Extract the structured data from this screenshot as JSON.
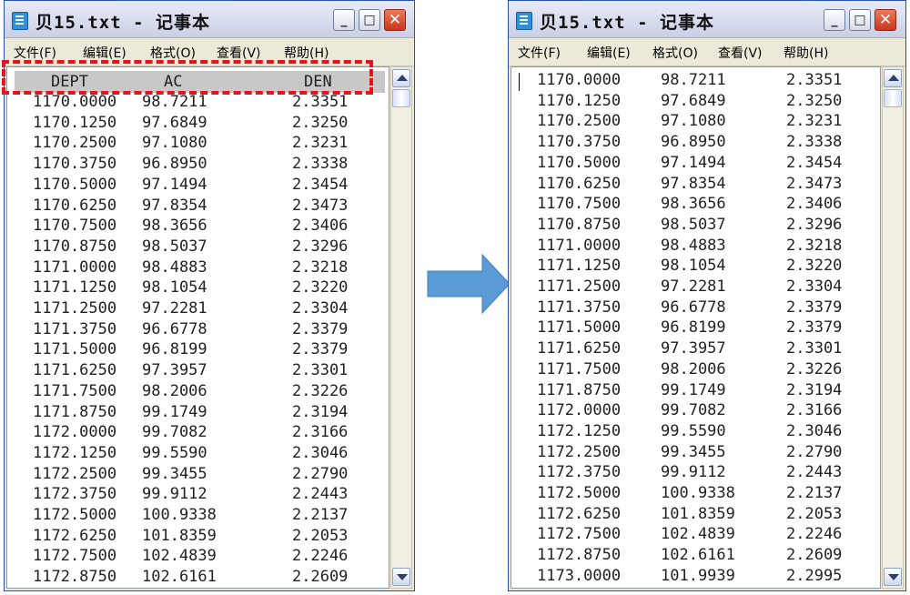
{
  "left_window": {
    "title": "贝15.txt - 记事本",
    "menu": [
      "文件(F)",
      "编辑(E)",
      "格式(O)",
      "查看(V)",
      "帮助(H)"
    ],
    "header": [
      "DEPT",
      "AC",
      "DEN"
    ],
    "rows": [
      [
        "1170.0000",
        "98.7211",
        "2.3351"
      ],
      [
        "1170.1250",
        "97.6849",
        "2.3250"
      ],
      [
        "1170.2500",
        "97.1080",
        "2.3231"
      ],
      [
        "1170.3750",
        "96.8950",
        "2.3338"
      ],
      [
        "1170.5000",
        "97.1494",
        "2.3454"
      ],
      [
        "1170.6250",
        "97.8354",
        "2.3473"
      ],
      [
        "1170.7500",
        "98.3656",
        "2.3406"
      ],
      [
        "1170.8750",
        "98.5037",
        "2.3296"
      ],
      [
        "1171.0000",
        "98.4883",
        "2.3218"
      ],
      [
        "1171.1250",
        "98.1054",
        "2.3220"
      ],
      [
        "1171.2500",
        "97.2281",
        "2.3304"
      ],
      [
        "1171.3750",
        "96.6778",
        "2.3379"
      ],
      [
        "1171.5000",
        "96.8199",
        "2.3379"
      ],
      [
        "1171.6250",
        "97.3957",
        "2.3301"
      ],
      [
        "1171.7500",
        "98.2006",
        "2.3226"
      ],
      [
        "1171.8750",
        "99.1749",
        "2.3194"
      ],
      [
        "1172.0000",
        "99.7082",
        "2.3166"
      ],
      [
        "1172.1250",
        "99.5590",
        "2.3046"
      ],
      [
        "1172.2500",
        "99.3455",
        "2.2790"
      ],
      [
        "1172.3750",
        "99.9112",
        "2.2443"
      ],
      [
        "1172.5000",
        "100.9338",
        "2.2137"
      ],
      [
        "1172.6250",
        "101.8359",
        "2.2053"
      ],
      [
        "1172.7500",
        "102.4839",
        "2.2246"
      ],
      [
        "1172.8750",
        "102.6161",
        "2.2609"
      ]
    ]
  },
  "right_window": {
    "title": "贝15.txt - 记事本",
    "menu": [
      "文件(F)",
      "编辑(E)",
      "格式(O)",
      "查看(V)",
      "帮助(H)"
    ],
    "rows": [
      [
        "1170.0000",
        "98.7211",
        "2.3351"
      ],
      [
        "1170.1250",
        "97.6849",
        "2.3250"
      ],
      [
        "1170.2500",
        "97.1080",
        "2.3231"
      ],
      [
        "1170.3750",
        "96.8950",
        "2.3338"
      ],
      [
        "1170.5000",
        "97.1494",
        "2.3454"
      ],
      [
        "1170.6250",
        "97.8354",
        "2.3473"
      ],
      [
        "1170.7500",
        "98.3656",
        "2.3406"
      ],
      [
        "1170.8750",
        "98.5037",
        "2.3296"
      ],
      [
        "1171.0000",
        "98.4883",
        "2.3218"
      ],
      [
        "1171.1250",
        "98.1054",
        "2.3220"
      ],
      [
        "1171.2500",
        "97.2281",
        "2.3304"
      ],
      [
        "1171.3750",
        "96.6778",
        "2.3379"
      ],
      [
        "1171.5000",
        "96.8199",
        "2.3379"
      ],
      [
        "1171.6250",
        "97.3957",
        "2.3301"
      ],
      [
        "1171.7500",
        "98.2006",
        "2.3226"
      ],
      [
        "1171.8750",
        "99.1749",
        "2.3194"
      ],
      [
        "1172.0000",
        "99.7082",
        "2.3166"
      ],
      [
        "1172.1250",
        "99.5590",
        "2.3046"
      ],
      [
        "1172.2500",
        "99.3455",
        "2.2790"
      ],
      [
        "1172.3750",
        "99.9112",
        "2.2443"
      ],
      [
        "1172.5000",
        "100.9338",
        "2.2137"
      ],
      [
        "1172.6250",
        "101.8359",
        "2.2053"
      ],
      [
        "1172.7500",
        "102.4839",
        "2.2246"
      ],
      [
        "1172.8750",
        "102.6161",
        "2.2609"
      ],
      [
        "1173.0000",
        "101.9939",
        "2.2995"
      ]
    ]
  },
  "icons": {
    "file": "notepad-icon",
    "minimize": "minimize-icon",
    "maximize": "maximize-icon",
    "close": "close-icon",
    "scroll_up": "scroll-up-icon",
    "scroll_down": "scroll-down-icon",
    "arrow": "right-arrow-icon"
  },
  "colors": {
    "highlight_border": "#e8121c",
    "arrow_fill": "#5b9bd5",
    "close_button": "#d2462a",
    "header_band": "#c8c8c8"
  }
}
